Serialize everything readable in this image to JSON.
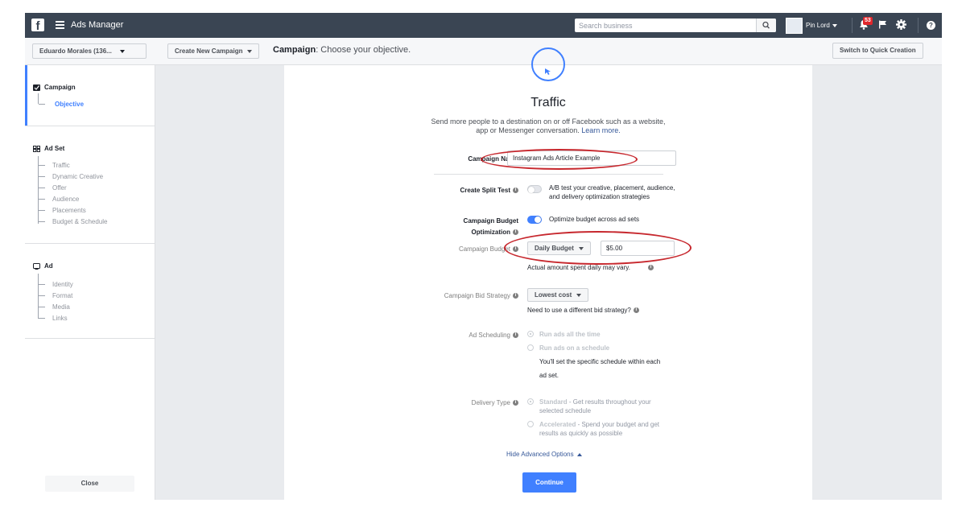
{
  "topbar": {
    "logo": "f",
    "app_title": "Ads Manager",
    "search_placeholder": "Search business",
    "page_name": "Pin Lord",
    "notification_count": "53",
    "help": "?"
  },
  "subheader": {
    "account": "Eduardo Morales (136...",
    "create_campaign": "Create New Campaign",
    "title_bold": "Campaign",
    "title_rest": ": Choose your objective.",
    "quick_creation": "Switch to Quick Creation"
  },
  "sidebar": {
    "campaign": {
      "label": "Campaign",
      "items": [
        "Objective"
      ]
    },
    "adset": {
      "label": "Ad Set",
      "items": [
        "Traffic",
        "Dynamic Creative",
        "Offer",
        "Audience",
        "Placements",
        "Budget & Schedule"
      ]
    },
    "ad": {
      "label": "Ad",
      "items": [
        "Identity",
        "Format",
        "Media",
        "Links"
      ]
    },
    "close": "Close"
  },
  "main": {
    "objective_title": "Traffic",
    "objective_desc": "Send more people to a destination on or off Facebook such as a website, app or Messenger conversation.",
    "learn_more": "Learn more.",
    "campaign_name_label": "Campaign Name",
    "campaign_name_value": "Instagram Ads Article Example",
    "split_test_label": "Create Split Test",
    "split_test_desc": "A/B test your creative, placement, audience, and delivery optimization strategies",
    "split_test_on": false,
    "cbo_label_1": "Campaign Budget",
    "cbo_label_2": "Optimization",
    "cbo_desc": "Optimize budget across ad sets",
    "cbo_on": true,
    "budget_label": "Campaign Budget",
    "budget_type": "Daily Budget",
    "budget_value": "$5.00",
    "budget_note": "Actual amount spent daily may vary.",
    "bid_label": "Campaign Bid Strategy",
    "bid_value": "Lowest cost",
    "bid_note": "Need to use a different bid strategy?",
    "scheduling_label": "Ad Scheduling",
    "scheduling_opt1": "Run ads all the time",
    "scheduling_opt2": "Run ads on a schedule",
    "scheduling_note_1": "You'll set the specific schedule within each",
    "scheduling_note_2": "ad set.",
    "delivery_label": "Delivery Type",
    "delivery_opt1_bold": "Standard",
    "delivery_opt1_rest_1": " - Get results throughout your",
    "delivery_opt1_rest_2": "selected schedule",
    "delivery_opt2_bold": "Accelerated",
    "delivery_opt2_rest_1": " - Spend your budget and get",
    "delivery_opt2_rest_2": "results as quickly as possible",
    "hide_advanced": "Hide Advanced Options",
    "continue": "Continue"
  },
  "colors": {
    "topbar": "#3a4553",
    "accent": "#4080ff",
    "link": "#365899",
    "annotation_ring": "#c7282e",
    "notification": "#e0262b"
  }
}
